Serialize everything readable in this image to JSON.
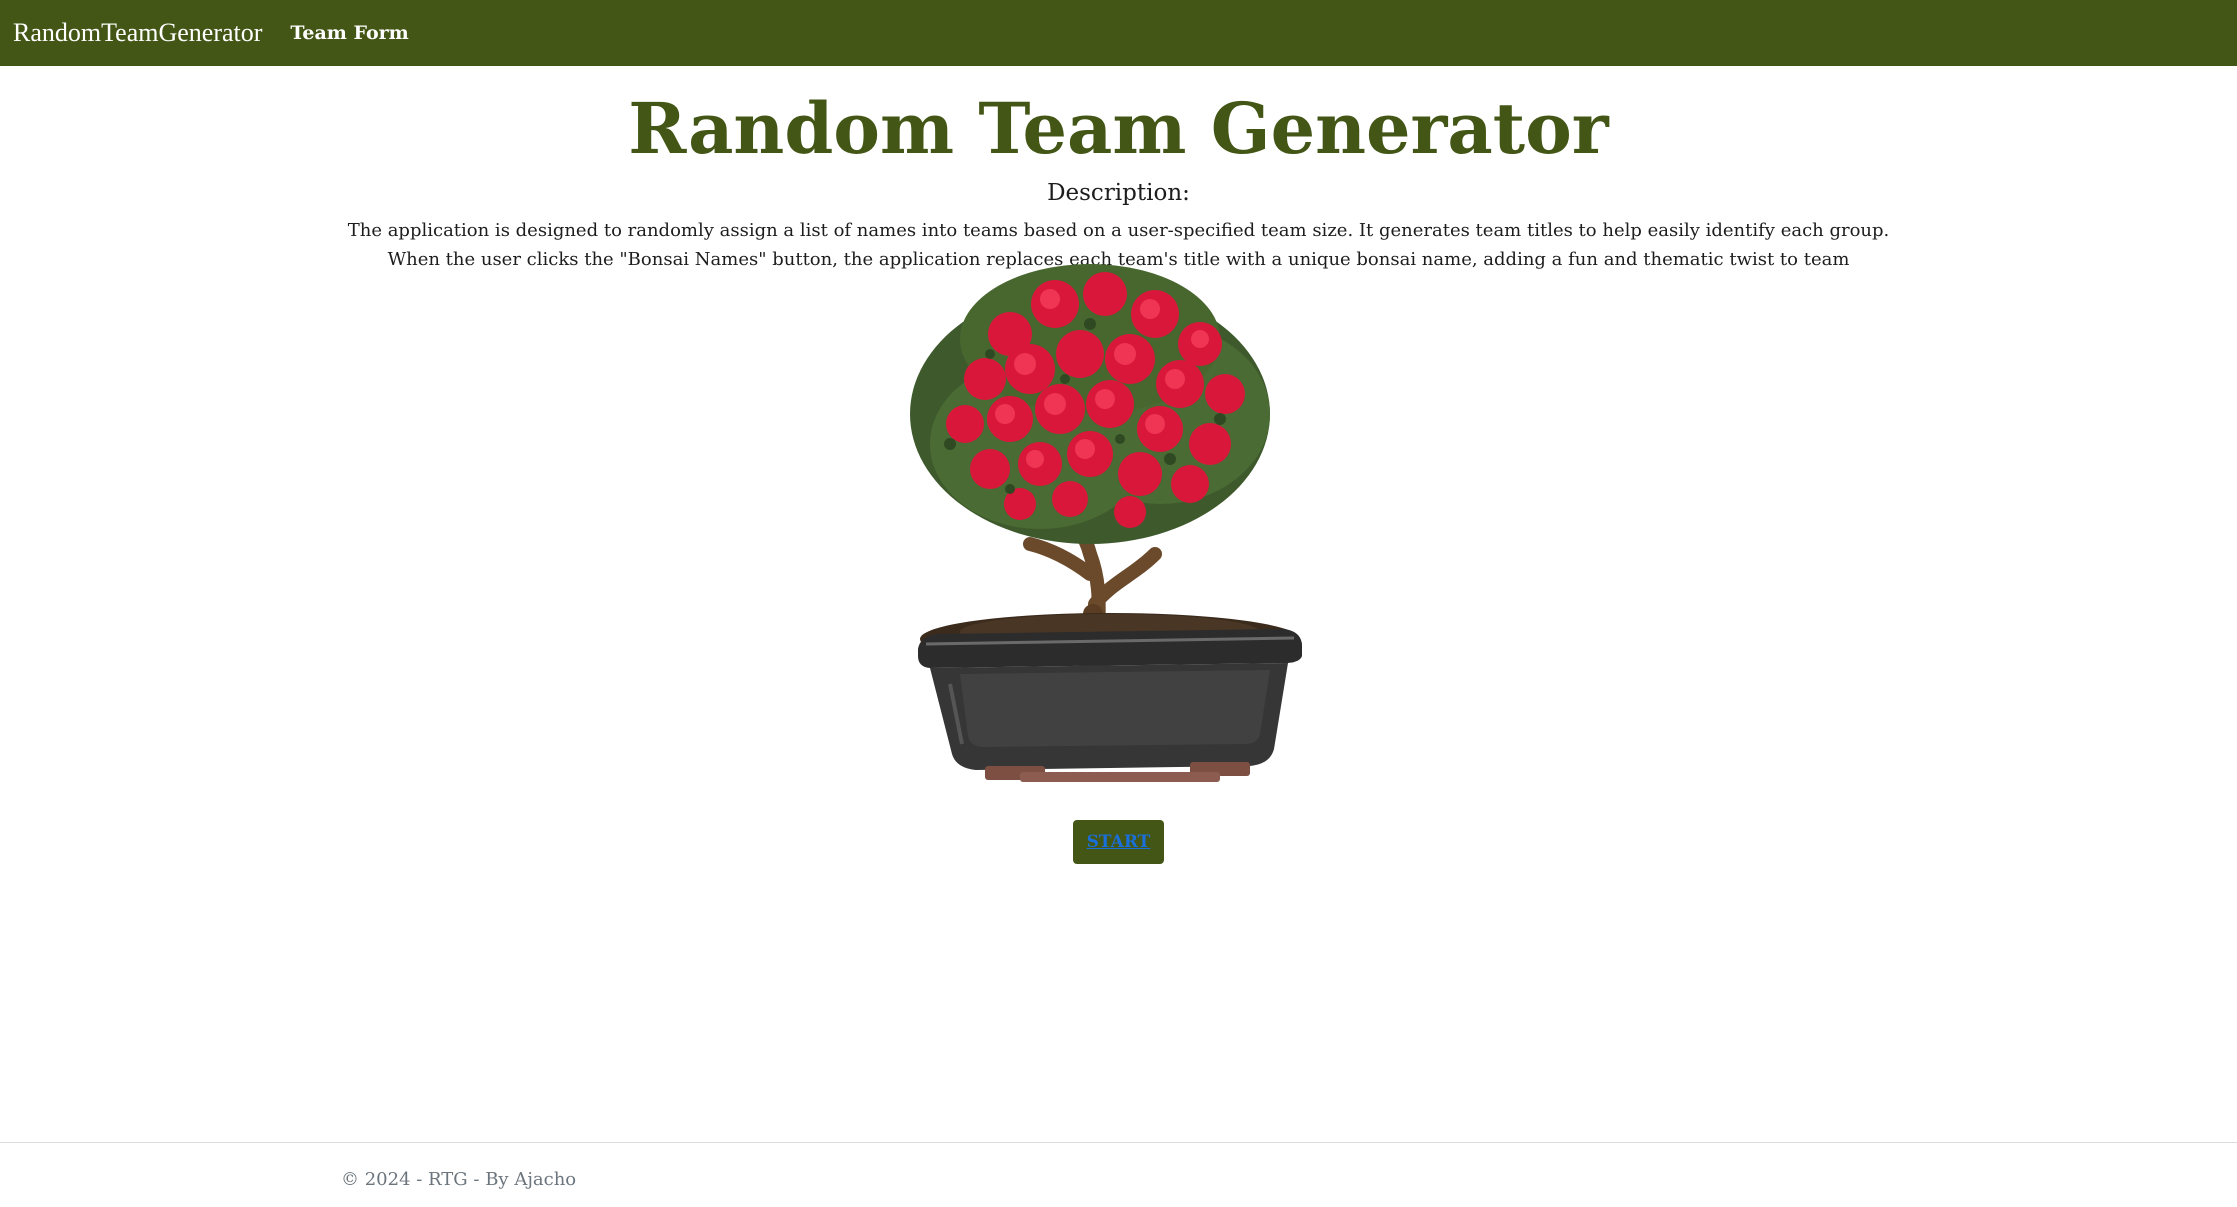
{
  "navbar": {
    "brand": "RandomTeamGenerator",
    "links": [
      {
        "label": "Team Form"
      }
    ],
    "bg_color": "#435615"
  },
  "main": {
    "title": "Random Team Generator",
    "description_heading": "Description:",
    "description_text": "The application is designed to randomly assign a list of names into teams based on a user-specified team size. It generates team titles to help easily identify each group. When the user clicks the \"Bonsai Names\" button, the application replaces each team's title with a unique bonsai name, adding a fun and thematic twist to team identification.",
    "image_subject": "bonsai-tree-image",
    "start_label": "START"
  },
  "footer": {
    "text": "© 2024 - RTG - By Ajacho"
  },
  "colors": {
    "accent": "#435615",
    "link": "#1a6fd8"
  }
}
